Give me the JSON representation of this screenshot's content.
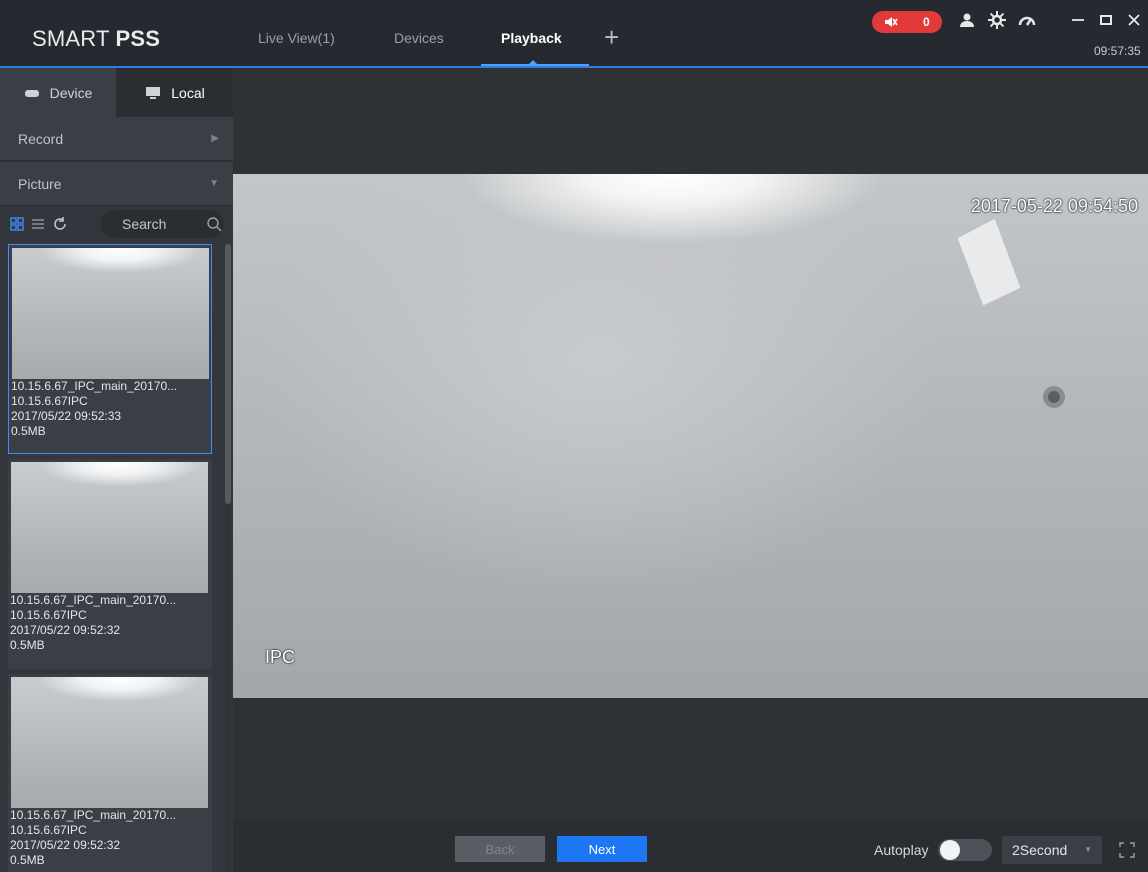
{
  "header": {
    "brand_prefix": "SMART",
    "brand_bold": "PSS",
    "tabs": [
      {
        "label": "Live View(1)",
        "active": false
      },
      {
        "label": "Devices",
        "active": false
      },
      {
        "label": "Playback",
        "active": true
      }
    ],
    "add_tab_icon": "plus-icon",
    "alarm_count": "0",
    "clock": "09:57:35",
    "accent_color": "#2f7fe0",
    "alarm_color": "#e23a3a"
  },
  "sidebar": {
    "source_tabs": [
      {
        "label": "Device",
        "icon": "hard-drive-icon",
        "active": false
      },
      {
        "label": "Local",
        "icon": "monitor-icon",
        "active": true
      }
    ],
    "sections": [
      {
        "label": "Record",
        "expanded": false
      },
      {
        "label": "Picture",
        "expanded": true
      }
    ],
    "search_placeholder": "Search",
    "pictures": [
      {
        "name": "10.15.6.67_IPC_main_20170...",
        "device": "10.15.6.67IPC",
        "time": "2017/05/22 09:52:33",
        "size": "0.5MB",
        "selected": true
      },
      {
        "name": "10.15.6.67_IPC_main_20170...",
        "device": "10.15.6.67IPC",
        "time": "2017/05/22 09:52:32",
        "size": "0.5MB",
        "selected": false
      },
      {
        "name": "10.15.6.67_IPC_main_20170...",
        "device": "10.15.6.67IPC",
        "time": "2017/05/22 09:52:32",
        "size": "0.5MB",
        "selected": false
      }
    ]
  },
  "viewer": {
    "osd_time": "2017-05-22 09:54:50",
    "osd_channel": "IPC"
  },
  "controls": {
    "back_label": "Back",
    "next_label": "Next",
    "autoplay_label": "Autoplay",
    "autoplay_on": false,
    "interval_value": "2Second"
  }
}
